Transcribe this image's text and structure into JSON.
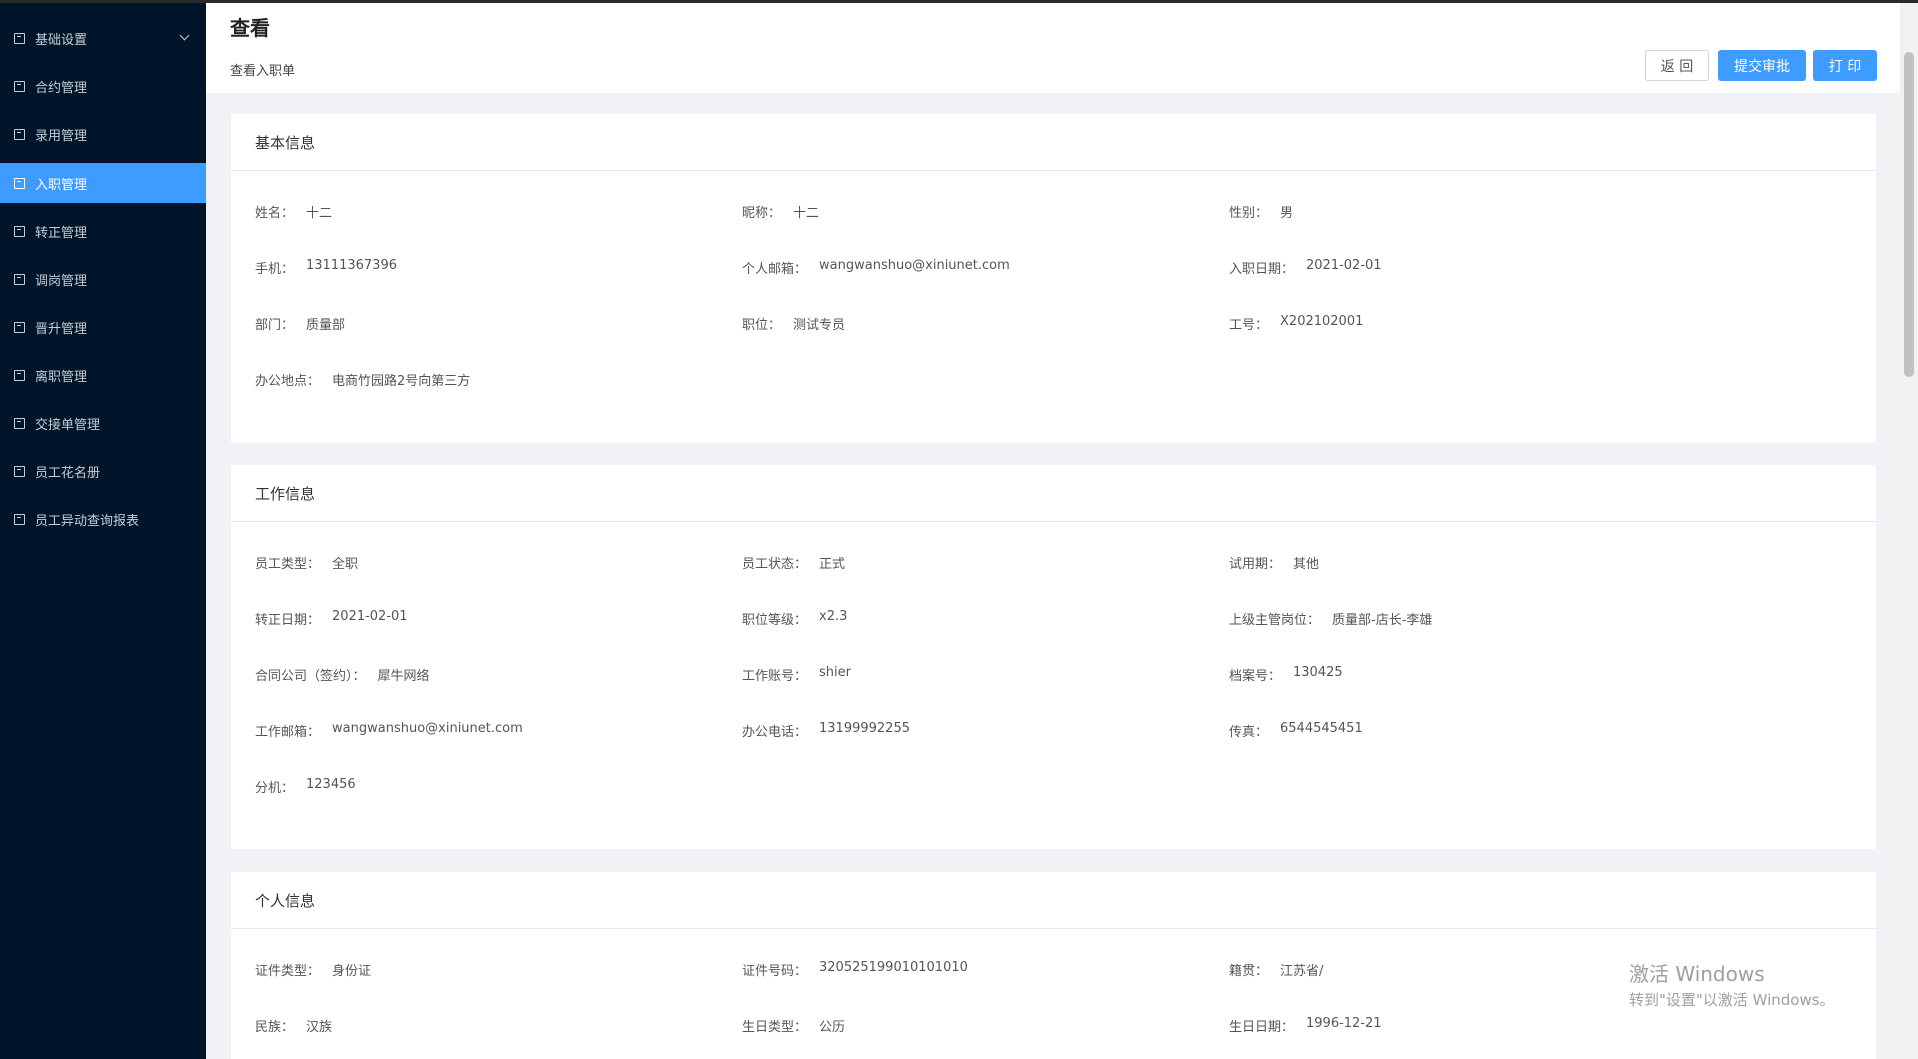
{
  "sidebar": {
    "items": [
      {
        "label": "基础设置",
        "icon": "mail-icon",
        "active": false,
        "expandable": true
      },
      {
        "label": "合约管理",
        "icon": "calendar-icon",
        "active": false
      },
      {
        "label": "录用管理",
        "icon": "file-icon",
        "active": false
      },
      {
        "label": "入职管理",
        "icon": "document-icon",
        "active": true
      },
      {
        "label": "转正管理",
        "icon": "grid-icon",
        "active": false
      },
      {
        "label": "调岗管理",
        "icon": "user-icon",
        "active": false
      },
      {
        "label": "晋升管理",
        "icon": "upgrade-icon",
        "active": false
      },
      {
        "label": "离职管理",
        "icon": "leave-icon",
        "active": false
      },
      {
        "label": "交接单管理",
        "icon": "copy-icon",
        "active": false
      },
      {
        "label": "员工花名册",
        "icon": "roster-icon",
        "active": false
      },
      {
        "label": "员工异动查询报表",
        "icon": "report-icon",
        "active": false
      }
    ]
  },
  "header": {
    "title": "查看",
    "subtitle": "查看入职单",
    "back_label": "返 回",
    "submit_label": "提交审批",
    "print_label": "打 印"
  },
  "sections": {
    "basic": {
      "title": "基本信息",
      "fields": [
        {
          "label": "姓名：",
          "value": "十二"
        },
        {
          "label": "昵称：",
          "value": "十二"
        },
        {
          "label": "性别：",
          "value": "男"
        },
        {
          "label": "手机：",
          "value": "13111367396"
        },
        {
          "label": "个人邮箱：",
          "value": "wangwanshuo@xiniunet.com"
        },
        {
          "label": "入职日期：",
          "value": "2021-02-01"
        },
        {
          "label": "部门：",
          "value": "质量部"
        },
        {
          "label": "职位：",
          "value": "测试专员"
        },
        {
          "label": "工号：",
          "value": "X202102001"
        },
        {
          "label": "办公地点：",
          "value": "电商竹园路2号向第三方"
        }
      ]
    },
    "work": {
      "title": "工作信息",
      "fields": [
        {
          "label": "员工类型：",
          "value": "全职"
        },
        {
          "label": "员工状态：",
          "value": "正式"
        },
        {
          "label": "试用期：",
          "value": "其他"
        },
        {
          "label": "转正日期：",
          "value": "2021-02-01"
        },
        {
          "label": "职位等级：",
          "value": "x2.3"
        },
        {
          "label": "上级主管岗位：",
          "value": "质量部-店长-李雄"
        },
        {
          "label": "合同公司（签约）：",
          "value": "犀牛网络"
        },
        {
          "label": "工作账号：",
          "value": "shier"
        },
        {
          "label": "档案号：",
          "value": "130425"
        },
        {
          "label": "工作邮箱：",
          "value": "wangwanshuo@xiniunet.com"
        },
        {
          "label": "办公电话：",
          "value": "13199992255"
        },
        {
          "label": "传真：",
          "value": "6544545451"
        },
        {
          "label": "分机：",
          "value": "123456"
        }
      ]
    },
    "personal": {
      "title": "个人信息",
      "fields": [
        {
          "label": "证件类型：",
          "value": "身份证"
        },
        {
          "label": "证件号码：",
          "value": "320525199010101010"
        },
        {
          "label": "籍贯：",
          "value": "江苏省/"
        },
        {
          "label": "民族：",
          "value": "汉族"
        },
        {
          "label": "生日类型：",
          "value": "公历"
        },
        {
          "label": "生日日期：",
          "value": "1996-12-21"
        }
      ]
    }
  },
  "watermark": {
    "line1": "激活 Windows",
    "line2": "转到\"设置\"以激活 Windows。"
  }
}
